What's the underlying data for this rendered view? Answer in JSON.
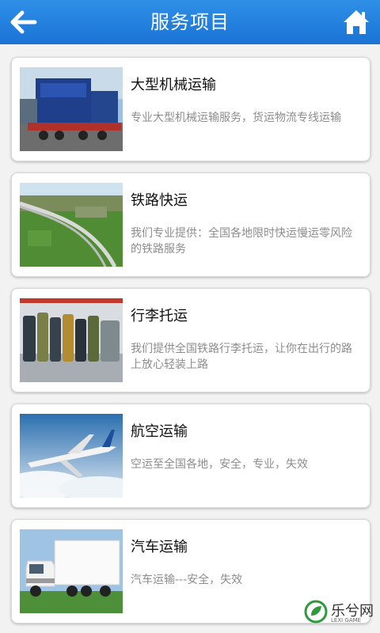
{
  "header": {
    "title": "服务项目",
    "back_icon": "back-arrow-icon",
    "home_icon": "home-icon"
  },
  "services": [
    {
      "name": "大型机械运输",
      "desc": "专业大型机械运输服务，货运物流专线运输",
      "image": "heavy-machinery-truck"
    },
    {
      "name": "铁路快运",
      "desc": "我们专业提供：全国各地限时快运慢运零风险的铁路服务",
      "image": "railway-landscape"
    },
    {
      "name": "行李托运",
      "desc": "我们提供全国铁路行李托运，让你在出行的路上放心轻装上路",
      "image": "luggage-row"
    },
    {
      "name": "航空运输",
      "desc": "空运至全国各地，安全，专业，失效",
      "image": "airplane-sky"
    },
    {
      "name": "汽车运输",
      "desc": "汽车运输---安全，失效",
      "image": "white-truck"
    }
  ],
  "watermark": {
    "text": "乐兮网",
    "sub": "LEXI GAME"
  },
  "colors": {
    "header": "#1a73d6",
    "desc_text": "#8c8c8c"
  }
}
